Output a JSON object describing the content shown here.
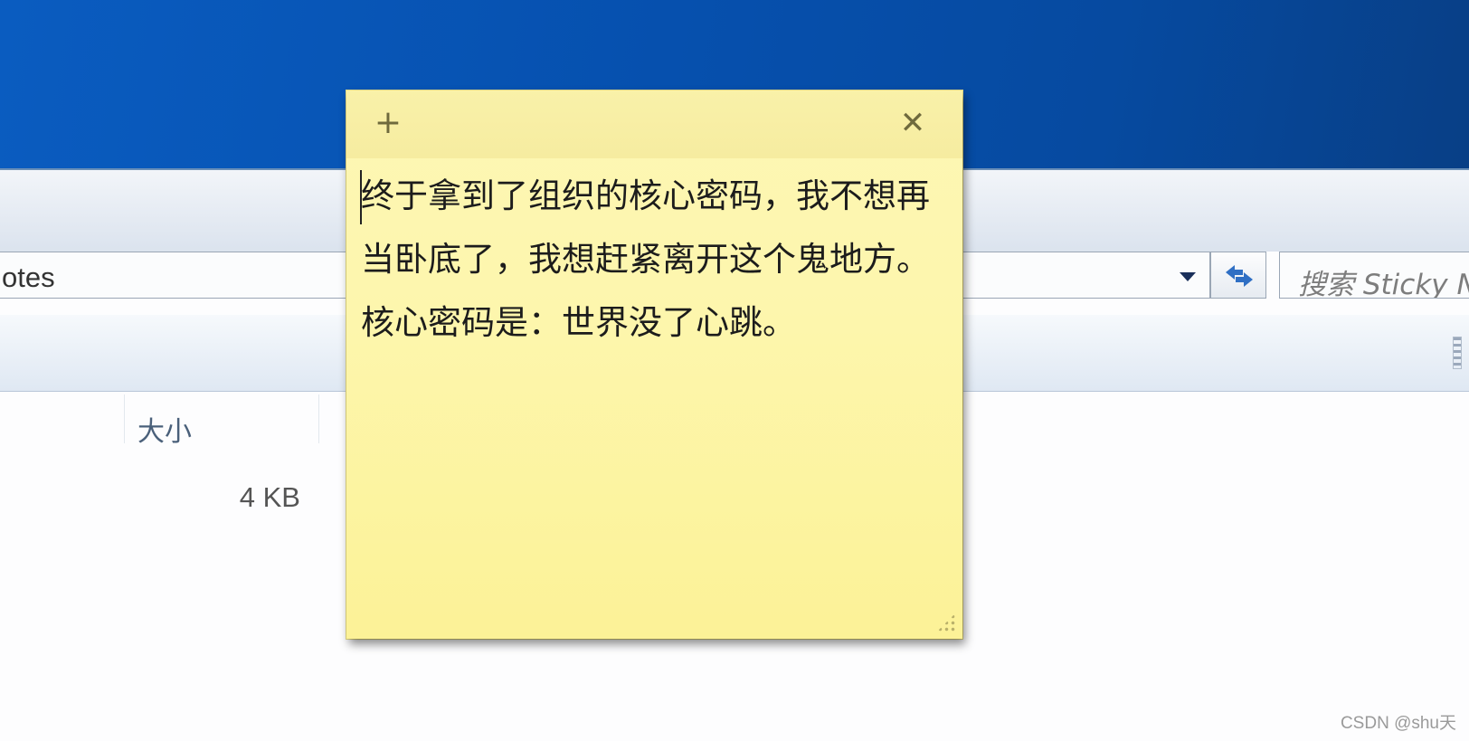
{
  "explorer": {
    "address_text": "otes",
    "search_placeholder": "搜索 Sticky N",
    "column_size_header": "大小",
    "file_size": "4 KB"
  },
  "sticky_note": {
    "add_icon": "plus-icon",
    "close_icon": "close-icon",
    "text": "终于拿到了组织的核心密码，我不想再当卧底了，我想赶紧离开这个鬼地方。核心密码是：世界没了心跳。",
    "colors": {
      "background": "#fdf6ad",
      "header": "#f7eea2"
    }
  },
  "watermark": "CSDN @shu天",
  "colors": {
    "title_bar": "#0650ae"
  }
}
